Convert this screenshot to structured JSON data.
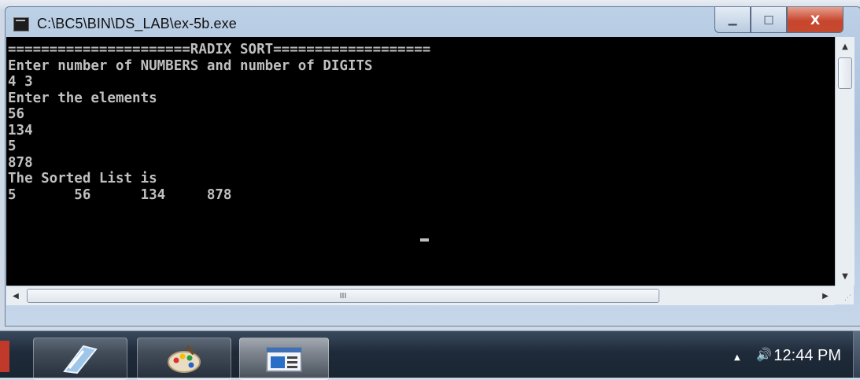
{
  "window": {
    "title": "C:\\BC5\\BIN\\DS_LAB\\ex-5b.exe",
    "controls": {
      "minimize": "▁",
      "maximize": "□",
      "close": "X"
    }
  },
  "console": {
    "lines": [
      "======================RADIX SORT===================",
      "Enter number of NUMBERS and number of DIGITS",
      "4 3",
      "Enter the elements",
      "56",
      "134",
      "5",
      "878",
      "The Sorted List is",
      "5       56      134     878"
    ],
    "foreground": "#c0c0c0",
    "background": "#000000"
  },
  "scrollbars": {
    "vertical": {
      "up": "▲",
      "down": "▼"
    },
    "horizontal": {
      "left": "◀",
      "right": "▶",
      "thumb_grip": "III"
    }
  },
  "taskbar": {
    "clock": "12:44 PM",
    "tray_up": "▲",
    "volume": "🔊",
    "buttons": [
      "file-manager-icon",
      "paint-icon",
      "console-window-icon"
    ]
  }
}
